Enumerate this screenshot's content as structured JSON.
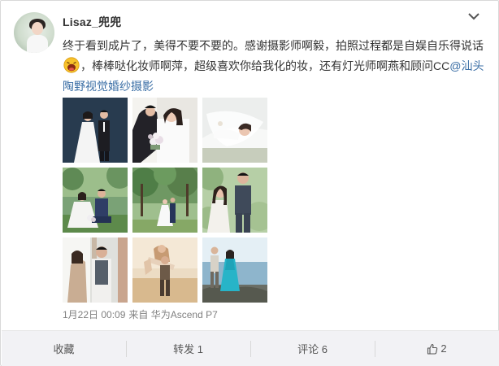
{
  "post": {
    "username": "Lisaz_兜兜",
    "text_before_emoji": "终于看到成片了，美得不要不要的。感谢摄影师啊毅，拍照过程都是自娱自乐得说话",
    "text_after_emoji": "，棒棒哒化妆师啊萍，超级喜欢你给我化的妆，还有灯光师啊燕和顾问CC",
    "mention": "@汕头陶野视觉婚纱摄影",
    "emoji_icon": "laughing-face-emoji",
    "date": "1月22日 00:09",
    "source": "来自 华为Ascend P7"
  },
  "photos": [
    {
      "name": "photo-couple-dark-backdrop"
    },
    {
      "name": "photo-couple-close-with-bouquet"
    },
    {
      "name": "photo-bride-lying-in-veil"
    },
    {
      "name": "photo-couple-sitting-on-lawn"
    },
    {
      "name": "photo-couple-standing-under-trees"
    },
    {
      "name": "photo-couple-in-garden"
    },
    {
      "name": "photo-couple-at-window"
    },
    {
      "name": "photo-couple-beach-lift"
    },
    {
      "name": "photo-couple-by-sea"
    }
  ],
  "actions": {
    "favorite": "收藏",
    "repost": "转发 1",
    "comment": "评论 6",
    "like_count": "2"
  },
  "colors": {
    "link": "#3a6ea5",
    "meta": "#808080",
    "action_bar_bg": "#f2f2f5"
  }
}
